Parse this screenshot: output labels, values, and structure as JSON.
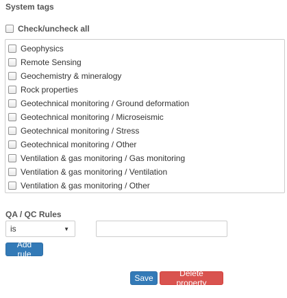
{
  "system_tags": {
    "title": "System tags",
    "check_all_label": "Check/uncheck all",
    "items": [
      {
        "label": "Geophysics",
        "checked": false
      },
      {
        "label": "Remote Sensing",
        "checked": false
      },
      {
        "label": "Geochemistry & mineralogy",
        "checked": false
      },
      {
        "label": "Rock properties",
        "checked": false
      },
      {
        "label": "Geotechnical monitoring / Ground deformation",
        "checked": false
      },
      {
        "label": "Geotechnical monitoring / Microseismic",
        "checked": false
      },
      {
        "label": "Geotechnical monitoring / Stress",
        "checked": false
      },
      {
        "label": "Geotechnical monitoring / Other",
        "checked": false
      },
      {
        "label": "Ventilation & gas monitoring / Gas monitoring",
        "checked": false
      },
      {
        "label": "Ventilation & gas monitoring / Ventilation",
        "checked": false
      },
      {
        "label": "Ventilation & gas monitoring / Other",
        "checked": false
      }
    ]
  },
  "qa_rules": {
    "title": "QA / QC Rules",
    "operator_selected": "is",
    "value": "",
    "add_rule_label": "Add rule"
  },
  "actions": {
    "save_label": "Save",
    "delete_label": "Delete property"
  },
  "colors": {
    "primary": "#337ab7",
    "danger": "#d9534f"
  }
}
